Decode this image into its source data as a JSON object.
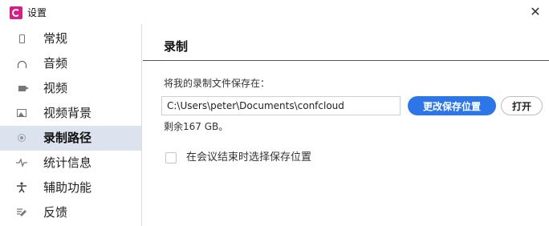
{
  "window": {
    "title": "设置",
    "app_icon": "app-logo-icon",
    "close_glyph": "✕",
    "accent_color": "#2d76e8",
    "brand_color": "#d21f8a"
  },
  "sidebar": {
    "items": [
      {
        "label": "常规",
        "icon": "general-icon",
        "active": false
      },
      {
        "label": "音频",
        "icon": "headphone-icon",
        "active": false
      },
      {
        "label": "视频",
        "icon": "camera-icon",
        "active": false
      },
      {
        "label": "视频背景",
        "icon": "image-icon",
        "active": false
      },
      {
        "label": "录制路径",
        "icon": "record-icon",
        "active": true
      },
      {
        "label": "统计信息",
        "icon": "pulse-icon",
        "active": false
      },
      {
        "label": "辅助功能",
        "icon": "accessibility-icon",
        "active": false
      },
      {
        "label": "反馈",
        "icon": "feedback-icon",
        "active": false
      }
    ]
  },
  "content": {
    "section_title": "录制",
    "path_label": "将我的录制文件保存在：",
    "path_value": "C:\\Users\\peter\\Documents\\confcloud",
    "change_location_button": "更改保存位置",
    "open_button": "打开",
    "free_space": "剩余167 GB。",
    "choose_location_checkbox": {
      "label": "在会议结束时选择保存位置",
      "checked": false
    }
  }
}
